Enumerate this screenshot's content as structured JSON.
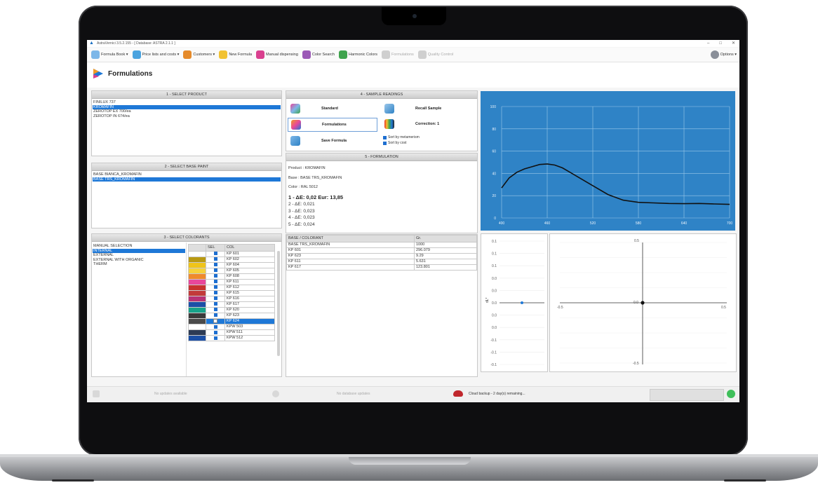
{
  "app": {
    "window_title": "AstraVernici 3.5.2.155 - [ Database: ASTRA 2.1.1 ]",
    "win_minimize": "–",
    "win_maximize": "□",
    "win_close": "✕"
  },
  "toolbar": {
    "items": [
      {
        "label": "Formula Book ▾",
        "icon": "book-icon",
        "color": "#7db7e8",
        "enabled": true
      },
      {
        "label": "Price lists and costs ▾",
        "icon": "price-list-icon",
        "color": "#4aa3df",
        "enabled": true
      },
      {
        "label": "Customers ▾",
        "icon": "customers-icon",
        "color": "#e58a2a",
        "enabled": true
      },
      {
        "label": "New Formula",
        "icon": "pencil-icon",
        "color": "#f1c232",
        "enabled": true
      },
      {
        "label": "Manual dispensing",
        "icon": "dispensing-icon",
        "color": "#d9408f",
        "enabled": true
      },
      {
        "label": "Color Search",
        "icon": "color-wheel-icon",
        "color": "#9b59b6",
        "enabled": true
      },
      {
        "label": "Harmonic Colors",
        "icon": "harmonic-icon",
        "color": "#3fa34d",
        "enabled": true
      },
      {
        "label": "Formulations",
        "icon": "formulations-icon",
        "color": "#cfcfcf",
        "enabled": false
      },
      {
        "label": "Quality Control",
        "icon": "quality-icon",
        "color": "#cfcfcf",
        "enabled": false
      }
    ],
    "options_label": "Options ▾"
  },
  "page": {
    "title": "Formulations"
  },
  "select_product": {
    "header": "1 - SELECT PRODUCT",
    "items": [
      "FINILUX 737",
      "KROMAFIN",
      "ZEROTOP EX 700/ea",
      "ZEROTOP IN 674/ea"
    ],
    "selected_index": 1
  },
  "select_base": {
    "header": "2 - SELECT BASE PAINT",
    "items": [
      "BASE BIANCA_KROMAFIN",
      "BASE TRS_KROMAFIN"
    ],
    "selected_index": 1
  },
  "select_colorants": {
    "header": "3 - SELECT COLORANTS",
    "groups": [
      "MANUAL SELECTION",
      "INTERNAL",
      "EXTERNAL",
      "EXTERNAL WITH ORGANIC",
      "THERM"
    ],
    "selected_index": 1,
    "col_sel": "SEL",
    "col_col": "COL",
    "rows": [
      {
        "swatch": "#ffffff",
        "code": "KP 601",
        "checked": true
      },
      {
        "swatch": "#b99a12",
        "code": "KP 602",
        "checked": true
      },
      {
        "swatch": "#f0c419",
        "code": "KP 604",
        "checked": true
      },
      {
        "swatch": "#f6d23c",
        "code": "KP 605",
        "checked": true
      },
      {
        "swatch": "#f08a2c",
        "code": "KP 608",
        "checked": true
      },
      {
        "swatch": "#e8479b",
        "code": "KP 611",
        "checked": true
      },
      {
        "swatch": "#c8312f",
        "code": "KP 612",
        "checked": true
      },
      {
        "swatch": "#c23a3a",
        "code": "KP 615",
        "checked": true
      },
      {
        "swatch": "#b83276",
        "code": "KP 616",
        "checked": true
      },
      {
        "swatch": "#1b4fa6",
        "code": "KP 617",
        "checked": true
      },
      {
        "swatch": "#17a38a",
        "code": "KP 620",
        "checked": true
      },
      {
        "swatch": "#3a3a3a",
        "code": "KP 623",
        "checked": true
      },
      {
        "swatch": "#4a4a4a",
        "code": "KP 624",
        "checked": false,
        "selected": true
      },
      {
        "swatch": "#ffffff",
        "code": "KPW 503",
        "checked": true
      },
      {
        "swatch": "#2d3b55",
        "code": "KPW 511",
        "checked": true
      },
      {
        "swatch": "#1b4fa6",
        "code": "KPW 512",
        "checked": true
      }
    ]
  },
  "sample_readings": {
    "header": "4 - SAMPLE READINGS",
    "standard_label": "Standard",
    "recall_label": "Recall Sample",
    "formulations_label": "Formulations",
    "correction_label": "Correction: 1",
    "save_label": "Save Formula",
    "sort_metamerism": "Sort by metamerism",
    "sort_cost": "Sort by cost"
  },
  "formulation": {
    "header": "5 - FORMULATION",
    "product": "Product : KROMAFIN",
    "base": "Base : BASE TRS_KROMAFIN",
    "color": "Color : RAL 5012",
    "results": [
      "1 - ΔE: 0,02 Eur: 13,85",
      "2 - ΔE: 0,021",
      "3 - ΔE: 0,023",
      "4 - ΔE: 0,023",
      "5 - ΔE: 0,024"
    ],
    "table_headers": [
      "BASE / COLORANT",
      "Gr."
    ],
    "table_rows": [
      [
        "BASE TRS_KROMAFIN",
        "1000"
      ],
      [
        "KP 601",
        "296.079"
      ],
      [
        "KP 623",
        "9.29"
      ],
      [
        "KP 611",
        "5.631"
      ],
      [
        "KP 617",
        "123.801"
      ]
    ]
  },
  "spectral_chart": {
    "bg": "#2f83c6",
    "yticks": [
      "100",
      "80",
      "60",
      "40",
      "20",
      "0"
    ],
    "xticks": [
      "400",
      "460",
      "520",
      "580",
      "640",
      "700"
    ]
  },
  "chart_data": [
    {
      "type": "line",
      "x": [
        400,
        410,
        420,
        430,
        440,
        450,
        460,
        470,
        480,
        490,
        500,
        520,
        540,
        560,
        580,
        600,
        620,
        640,
        660,
        680,
        700
      ],
      "series": [
        {
          "values": [
            27,
            36,
            41,
            44,
            46,
            48,
            48.5,
            47.5,
            45,
            41,
            37,
            29,
            21,
            16,
            14,
            13.5,
            13,
            12.8,
            13,
            12.6,
            12.2
          ]
        }
      ],
      "xlim": [
        400,
        700
      ],
      "ylim": [
        0,
        100
      ],
      "grid": true
    },
    {
      "type": "scatter",
      "x": [
        0
      ],
      "series": [
        {
          "values": [
            0
          ]
        }
      ],
      "yticks": [
        "0.1",
        "0.1",
        "0.1",
        "0.0",
        "0.0",
        "0.0",
        "0.0",
        "0.0",
        "-0.1",
        "-0.1",
        "-0.1"
      ],
      "ylabel": "dL*"
    },
    {
      "type": "scatter",
      "x": [
        0
      ],
      "series": [
        {
          "values": [
            0
          ]
        }
      ],
      "top_label": "0.5",
      "bottom_label": "-0.5",
      "left_label": "-0.5",
      "right_label": "0.5",
      "center_label": "0.0"
    }
  ],
  "status_bar": {
    "updates": "No updates available",
    "db_updates": "No database updates",
    "cloud_backup": "Cloud backup - 2 day(s) remaining..."
  }
}
